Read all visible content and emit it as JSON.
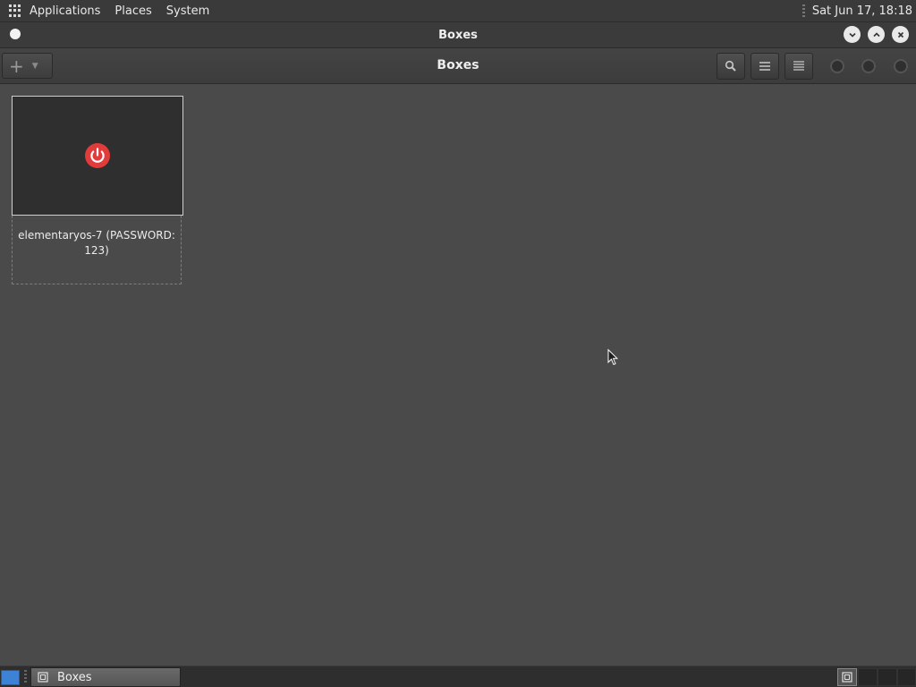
{
  "top_panel": {
    "menus": [
      "Applications",
      "Places",
      "System"
    ],
    "clock": "Sat Jun 17, 18:18"
  },
  "window": {
    "title": "Boxes",
    "controls": {
      "minimize": "minimize",
      "maximize": "maximize",
      "close": "close"
    }
  },
  "headerbar": {
    "title": "Boxes",
    "new_icon": "plus-icon",
    "buttons": [
      "search-icon",
      "list-view-icon",
      "menu-icon"
    ]
  },
  "boxes": [
    {
      "name": "elementaryos-7 (PASSWORD: 123)",
      "state_icon": "power-icon",
      "state_color": "#e23b3b"
    }
  ],
  "taskbar": {
    "tasks": [
      {
        "label": "Boxes"
      }
    ]
  },
  "colors": {
    "background": "#4a4a4a",
    "panel": "#3a3a3a",
    "accent": "#3e82d6"
  }
}
